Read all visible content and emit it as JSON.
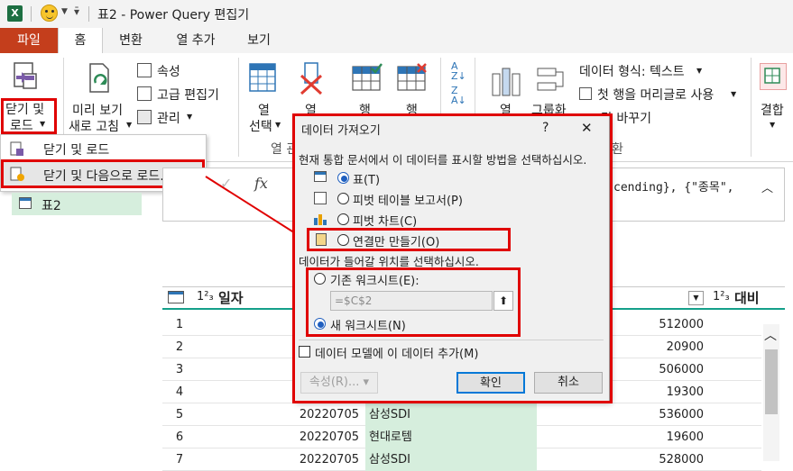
{
  "window": {
    "title": "표2 - Power Query 편집기"
  },
  "quick_access": {
    "smiley_label": "smiley-dropdown",
    "qa_menu": "quick-access-menu"
  },
  "tabs": [
    "파일",
    "홈",
    "변환",
    "열 추가",
    "보기"
  ],
  "ribbon": {
    "close_load_line1": "닫기 및",
    "close_load_line2": "로드",
    "preview_line1": "미리 보기",
    "preview_line2": "새로 고침",
    "properties": "속성",
    "advanced_editor": "고급 편집기",
    "manage": "관리",
    "choose_cols_line1": "열",
    "choose_cols_line2": "선택",
    "remove_cols_line1": "열",
    "keep_rows_line1": "행",
    "remove_rows_line1": "행",
    "split_col": "열",
    "group_by": "그룹화",
    "data_type": "데이터 형식: 텍스트",
    "first_row_header": "첫 행을 머리글로 사용",
    "replace_values": "값 바꾸기",
    "combine": "결합",
    "group_label_columns": "열 관",
    "group_label_transform": "환"
  },
  "close_menu": {
    "item1": "닫기 및 로드",
    "item2": "닫기 및 다음으로 로드..."
  },
  "queries": {
    "item": "표2"
  },
  "formula_bar": {
    "fx": "fx",
    "text": "cending}, {\"종목\","
  },
  "grid": {
    "col_date_header": "일자",
    "col_date_type": "1²₃",
    "col_value_header": "대비",
    "col_value_type": "1²₃",
    "rows": [
      {
        "n": "1",
        "date": "",
        "name": "",
        "val": "512000"
      },
      {
        "n": "2",
        "date": "",
        "name": "",
        "val": "20900"
      },
      {
        "n": "3",
        "date": "",
        "name": "",
        "val": "506000"
      },
      {
        "n": "4",
        "date": "",
        "name": "",
        "val": "19300"
      },
      {
        "n": "5",
        "date": "20220705",
        "name": "삼성SDI",
        "val": "536000"
      },
      {
        "n": "6",
        "date": "20220705",
        "name": "현대로템",
        "val": "19600"
      },
      {
        "n": "7",
        "date": "20220705",
        "name": "삼성SDI",
        "val": "528000"
      }
    ]
  },
  "dialog": {
    "title": "데이터 가져오기",
    "help": "?",
    "close": "✕",
    "prompt1": "현재 통합 문서에서 이 데이터를 표시할 방법을 선택하십시오.",
    "opt_table": "표(T)",
    "opt_pivot_table": "피벗 테이블 보고서(P)",
    "opt_pivot_chart": "피벗 차트(C)",
    "opt_connection": "연결만 만들기(O)",
    "prompt2": "데이터가 들어갈 위치를 선택하십시오.",
    "opt_existing": "기존 워크시트(E):",
    "cell_ref": "=$C$2",
    "opt_new": "새 워크시트(N)",
    "add_model": "데이터 모델에 이 데이터 추가(M)",
    "btn_props": "속성(R)...",
    "btn_ok": "확인",
    "btn_cancel": "취소"
  },
  "colors": {
    "accent_file": "#c43e1c",
    "highlight": "#e00000",
    "green_cell": "#d6eedd",
    "radio_blue": "#1f5fbf"
  }
}
